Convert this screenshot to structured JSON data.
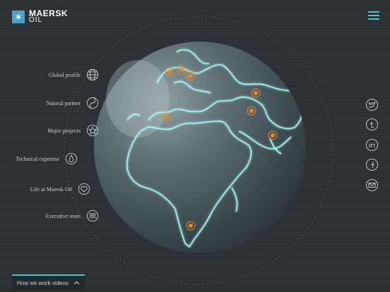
{
  "brand": {
    "line1": "MAERSK",
    "line2": "OIL",
    "star": "✶"
  },
  "menu_icon": "hamburger-icon",
  "nav": [
    {
      "label": "Global profile",
      "icon": "globe-icon"
    },
    {
      "label": "Natural partner",
      "icon": "yin-yang-icon"
    },
    {
      "label": "Major projects",
      "icon": "star-icon"
    },
    {
      "label": "Technical expertise",
      "icon": "drop-icon"
    },
    {
      "label": "Life at Maersk Oil",
      "icon": "heart-icon"
    },
    {
      "label": "Executive team",
      "icon": "people-icon"
    }
  ],
  "social": [
    "twitter-icon",
    "tumblr-icon",
    "linkedin-icon",
    "facebook-icon",
    "email-icon"
  ],
  "bottom": {
    "label": "How we work videos",
    "chevron": "^"
  },
  "colors": {
    "background": "#2a3034",
    "accent": "#4fc3c9",
    "glow": "#7fe8ee",
    "marker": "#e8892e",
    "globe": "#5e7277"
  }
}
